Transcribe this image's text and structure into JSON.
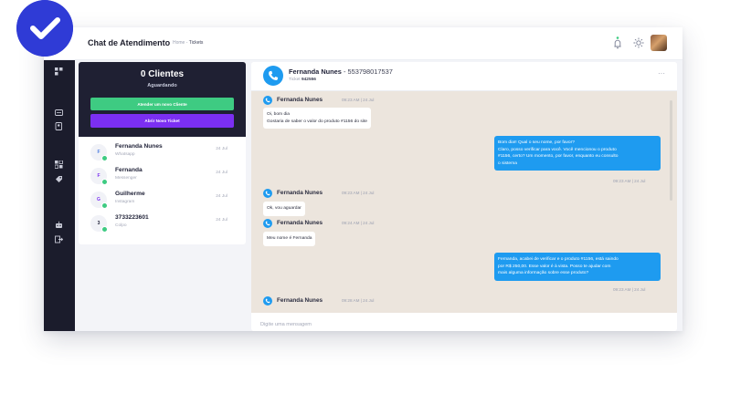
{
  "header": {
    "title": "Chat de Atendimento",
    "breadcrumb": {
      "home": "Home",
      "separator": "-",
      "current": "Tickets"
    }
  },
  "icons": {
    "badge": "check-badge-icon",
    "bell": "bell-icon",
    "theme": "sun-icon",
    "sidebar": [
      "grid-icon",
      "chat-icon",
      "contacts-icon",
      "dashboard-icon",
      "tag-icon",
      "robot-icon",
      "logout-icon"
    ]
  },
  "colors": {
    "sidebar": "#1b1c2c",
    "panel_header": "#1f2033",
    "green": "#3ecb82",
    "purple": "#7b2ff2",
    "blue": "#1e9bf0",
    "badge": "#2f3bd6",
    "chat_bg": "#ece5dd"
  },
  "tickets_panel": {
    "count": "0",
    "count_label": "Clientes",
    "waiting_label": "Aguardando",
    "answer_button": "Atender um novo Cliente",
    "new_ticket_button": "Abrir Novo Ticket",
    "items": [
      {
        "initial": "F",
        "name": "Fernanda Nunes",
        "channel": "Whatsapp",
        "date": "24 Jul"
      },
      {
        "initial": "F",
        "name": "Fernanda",
        "channel": "Messenger",
        "date": "24 Jul"
      },
      {
        "initial": "G",
        "name": "Guilherme",
        "channel": "Instagram",
        "date": "24 Jul"
      },
      {
        "initial": "3",
        "name": "3733223601",
        "channel": "Colpo",
        "date": "24 Jul"
      }
    ]
  },
  "chat": {
    "contact_name": "Fernanda Nunes",
    "contact_phone": "553798017537",
    "ticket_label": "Ticket",
    "ticket_number": "942556",
    "more": "···",
    "messages": [
      {
        "sender": "Fernanda Nunes",
        "time": "09:23 AM | 24 Jul",
        "lines": [
          "Oi, bom dia",
          "Gostaria de saber o valor do produto #1156 do site"
        ]
      },
      {
        "lines": [
          "Bom dia!! Qual o seu nome, por favor?",
          "Claro, posso verificar para você. Você mencionou o produto",
          "#1156, certo? Um momento, por favor, enquanto eu consulto",
          "o sistema"
        ],
        "time": "09:23 AM | 24 Jul"
      },
      {
        "sender": "Fernanda Nunes",
        "time": "09:23 AM | 24 Jul",
        "lines": [
          "Ok, vou aguardar"
        ]
      },
      {
        "sender": "Fernanda Nunes",
        "time": "09:24 AM | 24 Jul",
        "lines": [
          "Meu nome é Fernanda"
        ]
      },
      {
        "lines": [
          "Fernanda, acabei de verificar e o produto #1156, está saindo",
          "por R$ 250,00. Esse valor é à vista. Posso te ajudar com",
          "mais alguma informação sobre esse produto?"
        ],
        "time": "09:23 AM | 24 Jul"
      },
      {
        "sender": "Fernanda Nunes",
        "time": "09:28 AM | 24 Jul"
      }
    ],
    "input_placeholder": "Digite uma mensagem"
  }
}
